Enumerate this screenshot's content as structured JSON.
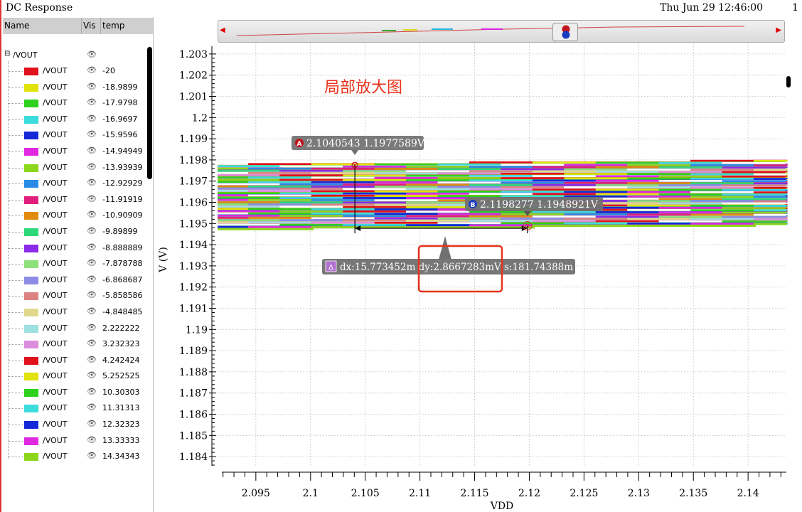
{
  "window": {
    "title": "DC Response",
    "timestamp": "Thu Jun 29 12:46:00",
    "page": "1"
  },
  "legend": {
    "headers": {
      "name": "Name",
      "vis": "Vis",
      "temp": "temp"
    },
    "root": "/VOUT",
    "eye_icon": "eye-icon",
    "rows": [
      {
        "label": "/VOUT",
        "temp": "-20",
        "color": "#e0101c"
      },
      {
        "label": "/VOUT",
        "temp": "-18.9899",
        "color": "#e2e20c"
      },
      {
        "label": "/VOUT",
        "temp": "-17.9798",
        "color": "#2ed11e"
      },
      {
        "label": "/VOUT",
        "temp": "-16.9697",
        "color": "#3cdcdc"
      },
      {
        "label": "/VOUT",
        "temp": "-15.9596",
        "color": "#1428d8"
      },
      {
        "label": "/VOUT",
        "temp": "-14.94949",
        "color": "#e028e0"
      },
      {
        "label": "/VOUT",
        "temp": "-13.93939",
        "color": "#8cd61c"
      },
      {
        "label": "/VOUT",
        "temp": "-12.92929",
        "color": "#2a8be6"
      },
      {
        "label": "/VOUT",
        "temp": "-11.91919",
        "color": "#e21e7c"
      },
      {
        "label": "/VOUT",
        "temp": "-10.90909",
        "color": "#e08a10"
      },
      {
        "label": "/VOUT",
        "temp": "-9.89899",
        "color": "#2ed87a"
      },
      {
        "label": "/VOUT",
        "temp": "-8.888889",
        "color": "#8a2ae8"
      },
      {
        "label": "/VOUT",
        "temp": "-7.878788",
        "color": "#8ee07a"
      },
      {
        "label": "/VOUT",
        "temp": "-6.868687",
        "color": "#8c8ce6"
      },
      {
        "label": "/VOUT",
        "temp": "-5.858586",
        "color": "#dc8282"
      },
      {
        "label": "/VOUT",
        "temp": "-4.848485",
        "color": "#e0d88c"
      },
      {
        "label": "/VOUT",
        "temp": "2.222222",
        "color": "#9ce0e0"
      },
      {
        "label": "/VOUT",
        "temp": "3.232323",
        "color": "#dc8cdc"
      },
      {
        "label": "/VOUT",
        "temp": "4.242424",
        "color": "#e0101c"
      },
      {
        "label": "/VOUT",
        "temp": "5.252525",
        "color": "#e2e20c"
      },
      {
        "label": "/VOUT",
        "temp": "10.30303",
        "color": "#2ed11e"
      },
      {
        "label": "/VOUT",
        "temp": "11.31313",
        "color": "#3cdcdc"
      },
      {
        "label": "/VOUT",
        "temp": "12.32323",
        "color": "#1428d8"
      },
      {
        "label": "/VOUT",
        "temp": "13.33333",
        "color": "#e028e0"
      },
      {
        "label": "/VOUT",
        "temp": "14.34343",
        "color": "#8cd61c"
      }
    ]
  },
  "annotation_text": "局部放大图",
  "annotation_color": "#e8331c",
  "markers": {
    "a": {
      "tag": "A",
      "text": "2.1040543 1.1977589V",
      "x": 2.1040543,
      "y": 1.1977589,
      "color": "#c0141c"
    },
    "b": {
      "tag": "B",
      "text": "2.1198277 1.1948921V",
      "x": 2.1198277,
      "y": 1.1948921,
      "color": "#1c3cc0"
    },
    "delta": {
      "tag": "Δ",
      "text": "dx:15.773452m dy:2.8667283mV s:181.74388m"
    }
  },
  "chart_data": {
    "type": "line",
    "xlabel": "VDD",
    "ylabel": "V (V)",
    "xlim": [
      2.0915,
      2.1435
    ],
    "ylim": [
      1.1835,
      1.2035
    ],
    "x_ticks": [
      "2.095",
      "2.1",
      "2.105",
      "2.11",
      "2.115",
      "2.12",
      "2.125",
      "2.13",
      "2.135",
      "2.14"
    ],
    "y_ticks": [
      "1.203",
      "1.202",
      "1.201",
      "1.2",
      "1.199",
      "1.198",
      "1.197",
      "1.196",
      "1.195",
      "1.194",
      "1.193",
      "1.192",
      "1.191",
      "1.19",
      "1.189",
      "1.188",
      "1.187",
      "1.186",
      "1.185",
      "1.184"
    ],
    "grid": true,
    "series_band": {
      "x": [
        2.0915,
        2.1435
      ],
      "y_low": [
        1.19475,
        1.19495
      ],
      "y_high": [
        1.19775,
        1.19795
      ],
      "count": 100
    }
  }
}
